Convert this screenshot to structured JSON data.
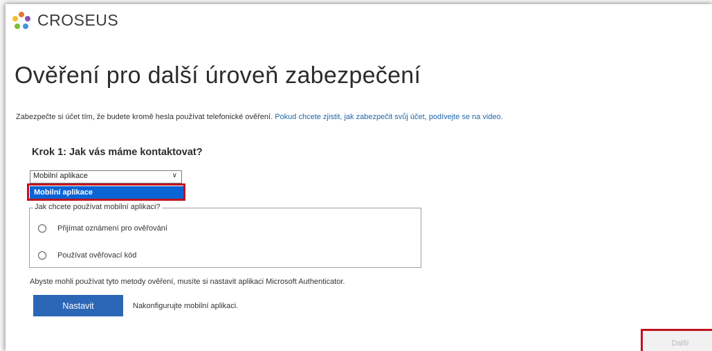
{
  "brand": {
    "name": "CROSEUS",
    "logo_colors": [
      "#e8762d",
      "#8a4fb3",
      "#3a9ad9",
      "#7cbf3a",
      "#f2c12e"
    ]
  },
  "page": {
    "title": "Ověření pro další úroveň zabezpečení",
    "intro_text": "Zabezpečte si účet tím, že budete kromě hesla používat telefonické ověření.",
    "intro_link": "Pokud chcete zjistit, jak zabezpečit svůj účet, podívejte se na video."
  },
  "step1": {
    "heading": "Krok 1: Jak vás máme kontaktovat?",
    "select_value": "Mobilní aplikace",
    "dropdown_options": [
      "Mobilní aplikace"
    ],
    "mobile_app_group": {
      "legend": "Jak chcete používat mobilní aplikaci?",
      "options": [
        "Přijímat oznámení pro ověřování",
        "Používat ověřovací kód"
      ]
    },
    "hint": "Abyste mohli používat tyto metody ověření, musíte si nastavit aplikaci Microsoft Authenticator.",
    "setup_button": "Nastavit",
    "setup_note": "Nakonfigurujte mobilní aplikaci."
  },
  "footer": {
    "next_button": "Další"
  },
  "colors": {
    "accent": "#2b67b6",
    "highlight_red": "#c0121c",
    "dropdown_selected": "#0a64d6",
    "link": "#2066a8"
  },
  "icons": {
    "select_chevron": "chevron-down-icon",
    "logo": "croseus-logo-icon"
  }
}
